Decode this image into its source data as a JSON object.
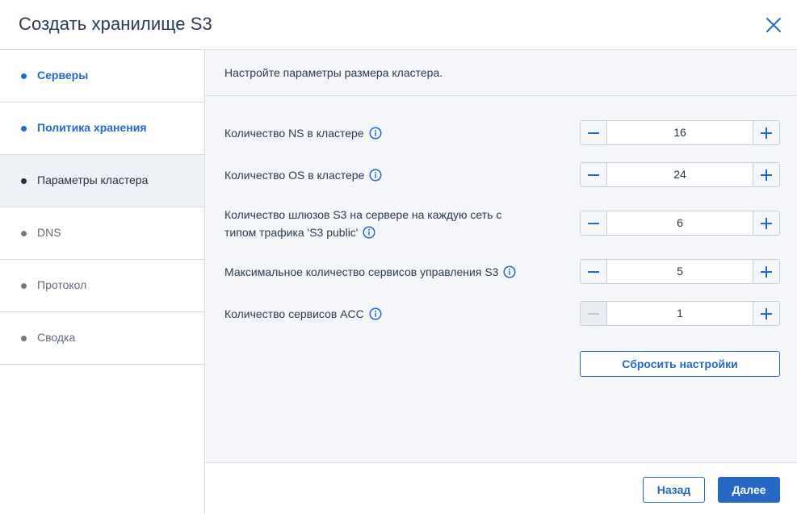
{
  "dialog": {
    "title": "Создать хранилище S3"
  },
  "sidebar": {
    "steps": [
      {
        "label": "Серверы",
        "state": "done"
      },
      {
        "label": "Политика хранения",
        "state": "done"
      },
      {
        "label": "Параметры кластера",
        "state": "active"
      },
      {
        "label": "DNS",
        "state": "todo"
      },
      {
        "label": "Протокол",
        "state": "todo"
      },
      {
        "label": "Сводка",
        "state": "todo"
      }
    ]
  },
  "main": {
    "description": "Настройте параметры размера кластера.",
    "fields": [
      {
        "label": "Количество NS в кластере",
        "value": "16"
      },
      {
        "label": "Количество OS в кластере",
        "value": "24"
      },
      {
        "label_line1": "Количество шлюзов S3 на сервере на каждую сеть с",
        "label_line2": "типом трафика 'S3 public'",
        "value": "6"
      },
      {
        "label": "Максимальное количество сервисов управления S3",
        "value": "5"
      },
      {
        "label": "Количество сервисов ACC",
        "value": "1",
        "minus_disabled": true
      }
    ],
    "reset_label": "Сбросить настройки"
  },
  "footer": {
    "back_label": "Назад",
    "next_label": "Далее"
  },
  "colors": {
    "accent": "#2668c5",
    "text": "#243143",
    "panel_bg": "#f4f6fa",
    "border": "#d7dde5"
  }
}
